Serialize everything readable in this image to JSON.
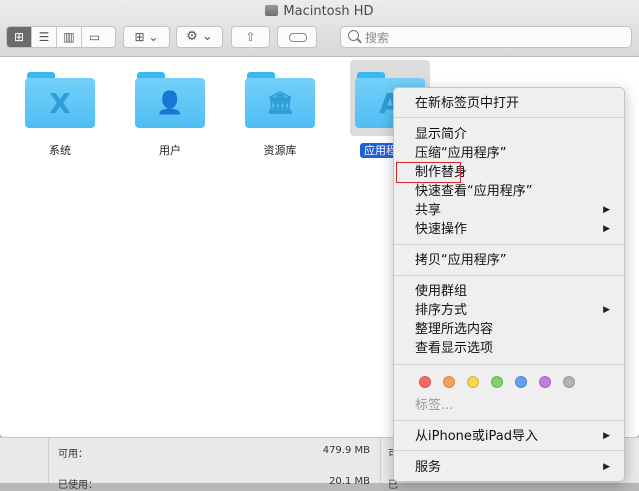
{
  "window": {
    "title": "Macintosh HD",
    "search_placeholder": "搜索"
  },
  "toolbar": {
    "view_icons": [
      "icon-view-icon",
      "list-view-icon",
      "column-view-icon",
      "gallery-view-icon"
    ],
    "arrange_glyph": "⊞ ⌄",
    "action_glyph": "⚙ ⌄",
    "share_glyph": "⇧"
  },
  "items": [
    {
      "label": "系统",
      "glyph": "X"
    },
    {
      "label": "用户",
      "glyph": "👤"
    },
    {
      "label": "资源库",
      "glyph": "🏛"
    },
    {
      "label": "应用程序",
      "glyph": "A"
    }
  ],
  "menu": {
    "open_new_tab": "在新标签页中打开",
    "get_info": "显示简介",
    "compress": "压缩“应用程序”",
    "make_alias": "制作替身",
    "quick_look": "快速查看“应用程序”",
    "share": "共享",
    "quick_actions": "快速操作",
    "copy": "拷贝“应用程序”",
    "use_groups": "使用群组",
    "sort_by": "排序方式",
    "clean_up": "整理所选内容",
    "show_view_options": "查看显示选项",
    "tags": "标签...",
    "import_iphone": "从iPhone或iPad导入",
    "services": "服务",
    "tag_colors": [
      "#f26b6b",
      "#f6a25a",
      "#f5d74f",
      "#7ed36a",
      "#5fa2f0",
      "#c779e0",
      "#b3b3b3"
    ]
  },
  "status": {
    "available_label": "可用：",
    "available_value": "479.9 MB",
    "used_label": "已使用：",
    "used_value": "20.1 MB",
    "frag1": "可",
    "frag2": "已"
  }
}
